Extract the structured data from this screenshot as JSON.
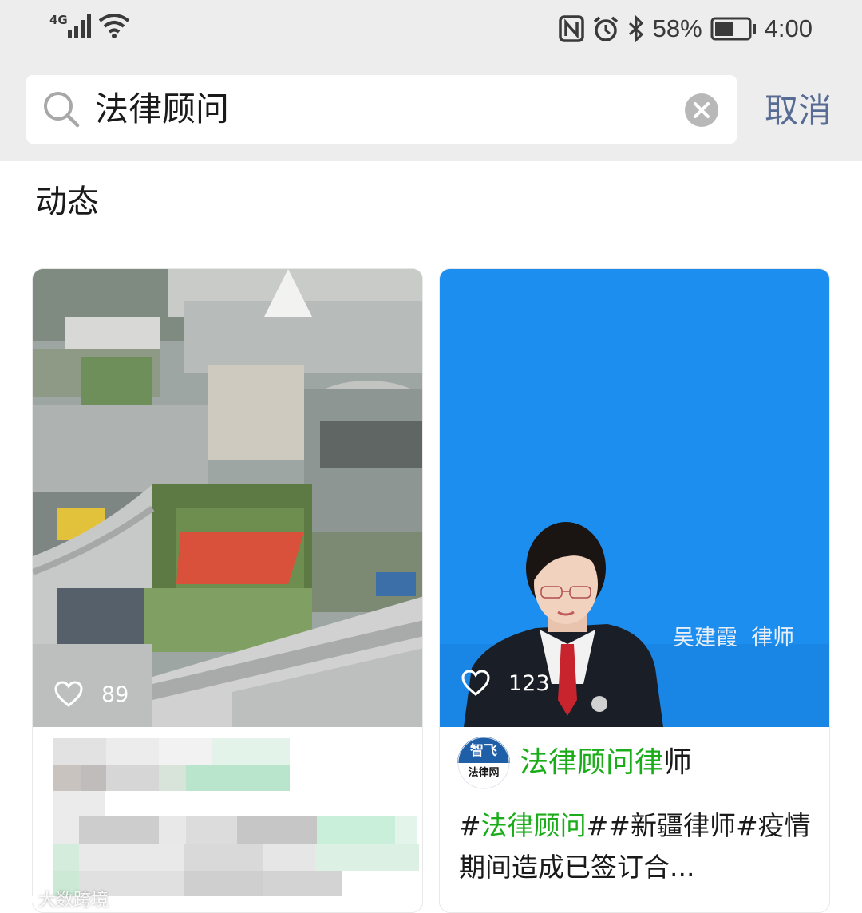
{
  "status_bar": {
    "network_type": "4G",
    "battery_percent": "58%",
    "battery_level": 0.58,
    "time": "4:00"
  },
  "search": {
    "query": "法律顾问",
    "cancel_label": "取消"
  },
  "section": {
    "title": "动态"
  },
  "cards": [
    {
      "likes": "89"
    },
    {
      "likes": "123",
      "photo_caption": "吴建霞  律师",
      "author_logo_top": "智飞",
      "author_logo_bottom": "法律网",
      "author_name_highlight": "法律顾问律",
      "author_name_rest": "师",
      "desc_part1": "#",
      "desc_highlight": "法律顾问",
      "desc_part2": "##新疆律师#疫情期间造成已签订合..."
    }
  ],
  "watermark": "大数跨境",
  "colors": {
    "highlight_green": "#1aad19",
    "link_blue": "#576b95",
    "card_photo_blue": "#1c8ef0"
  }
}
